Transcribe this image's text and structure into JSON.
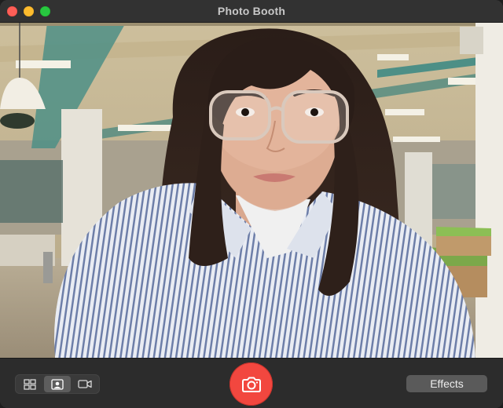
{
  "window": {
    "title": "Photo Booth"
  },
  "traffic_lights": {
    "close": "#fe5f57",
    "minimize": "#febc2e",
    "zoom": "#28c840"
  },
  "preview": {
    "content": "live camera preview"
  },
  "toolbar": {
    "modes": [
      {
        "icon": "grid-icon",
        "selected": false
      },
      {
        "icon": "portrait-icon",
        "selected": true
      },
      {
        "icon": "video-camera-icon",
        "selected": false
      }
    ],
    "shutter_icon": "camera-icon",
    "shutter_color": "#f2473f",
    "effects_label": "Effects"
  }
}
